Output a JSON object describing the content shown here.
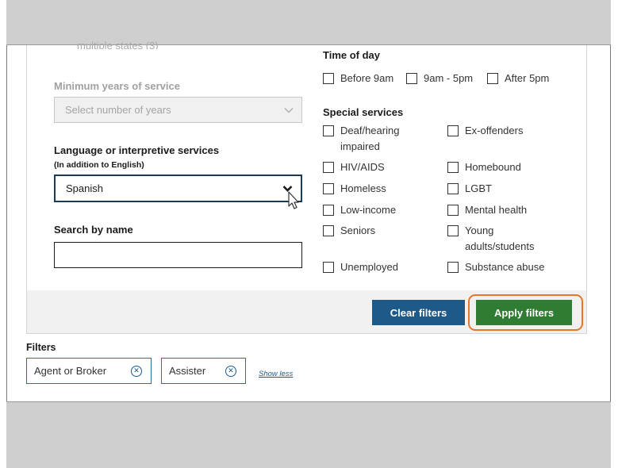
{
  "left": {
    "cutoff_text": "multiple states (3)",
    "min_years": {
      "label": "Minimum years of service",
      "placeholder": "Select number of years"
    },
    "language": {
      "label": "Language or interpretive services",
      "sublabel": "(In addition to English)",
      "value": "Spanish"
    },
    "search_name": {
      "label": "Search by name",
      "value": ""
    }
  },
  "right": {
    "time_of_day": {
      "label": "Time of day",
      "options": [
        "Before 9am",
        "9am - 5pm",
        "After 5pm"
      ]
    },
    "special_services": {
      "label": "Special services",
      "col1": [
        "Deaf/hearing impaired",
        "HIV/AIDS",
        "Homeless",
        "Low-income",
        "Seniors",
        "Unemployed"
      ],
      "col2": [
        "Ex-offenders",
        "Homebound",
        "LGBT",
        "Mental health",
        "Young adults/students",
        "Substance abuse"
      ]
    }
  },
  "buttons": {
    "clear": "Clear filters",
    "apply": "Apply filters"
  },
  "filters": {
    "title": "Filters",
    "chips": [
      "Agent or Broker",
      "Assister"
    ],
    "show_less": "Show less"
  },
  "icons": {
    "select_chevron": "chevron-down-icon",
    "chip_remove": "close-circle-icon",
    "cursor": "pointer-arrow-icon"
  },
  "colors": {
    "clear_button": "#1d5a8a",
    "apply_button": "#2e7d32",
    "highlight_ring": "#e8752a",
    "chip_border": "#2c6fa0"
  }
}
